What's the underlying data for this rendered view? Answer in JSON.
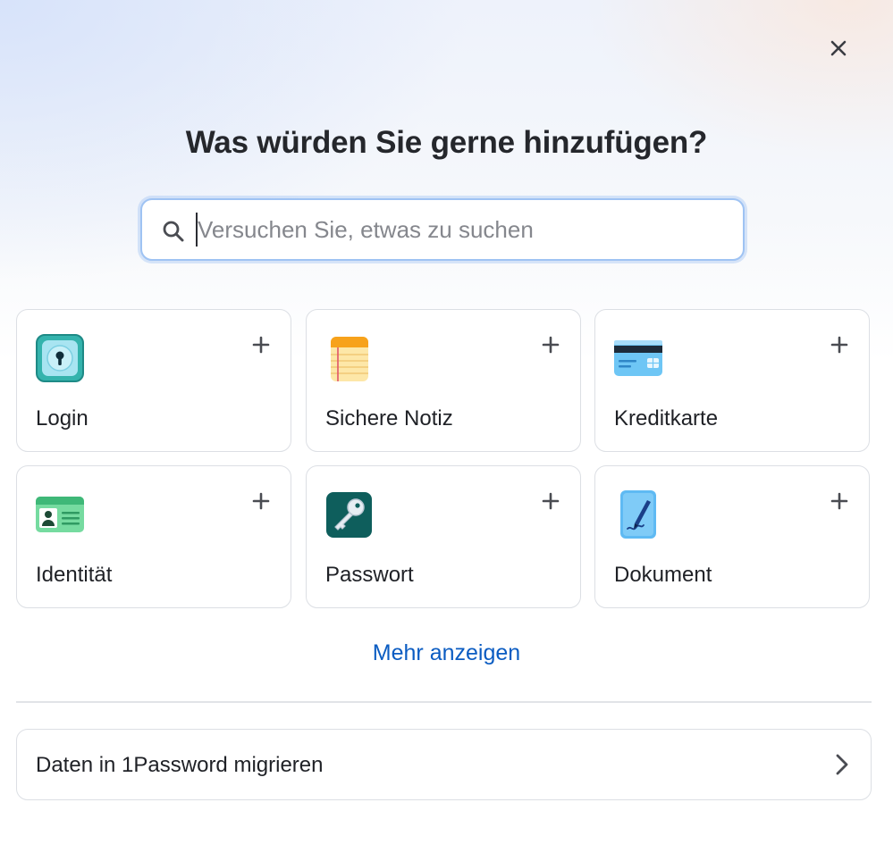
{
  "dialog": {
    "title": "Was würden Sie gerne hinzufügen?",
    "close_icon": "close-icon"
  },
  "search": {
    "placeholder": "Versuchen Sie, etwas zu suchen",
    "value": "",
    "icon": "search-icon"
  },
  "items": [
    {
      "label": "Login",
      "icon": "login-icon"
    },
    {
      "label": "Sichere Notiz",
      "icon": "secure-note-icon"
    },
    {
      "label": "Kreditkarte",
      "icon": "credit-card-icon"
    },
    {
      "label": "Identität",
      "icon": "identity-icon"
    },
    {
      "label": "Passwort",
      "icon": "password-icon"
    },
    {
      "label": "Dokument",
      "icon": "document-icon"
    }
  ],
  "more_link": "Mehr anzeigen",
  "migrate": {
    "label": "Daten in 1Password migrieren",
    "icon": "chevron-right-icon"
  },
  "colors": {
    "accent_link": "#0b5cc2",
    "search_focus_border": "#9fc3f3",
    "card_border": "#dcdfe4"
  }
}
